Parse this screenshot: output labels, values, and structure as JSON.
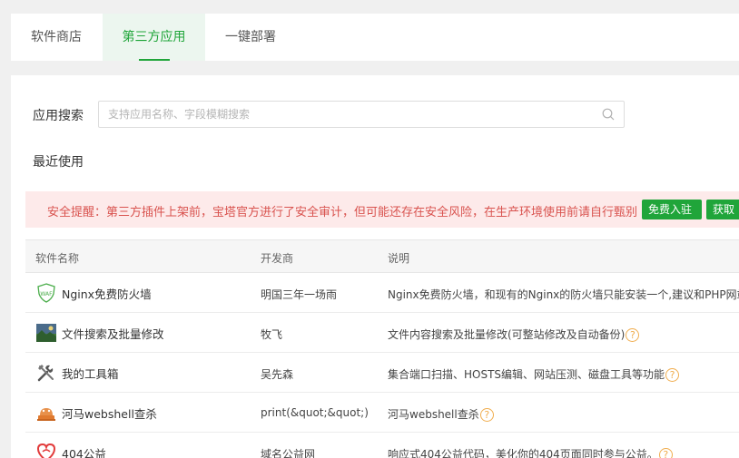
{
  "tabs": [
    {
      "label": "软件商店"
    },
    {
      "label": "第三方应用"
    },
    {
      "label": "一键部署"
    }
  ],
  "search": {
    "label": "应用搜索",
    "placeholder": "支持应用名称、字段模糊搜索"
  },
  "recent": {
    "label": "最近使用"
  },
  "alert": {
    "text": "安全提醒：第三方插件上架前，宝塔官方进行了安全审计，但可能还存在安全风险，在生产环境使用前请自行甄别",
    "button1": "免费入驻",
    "button2": "获取"
  },
  "table": {
    "headers": [
      "软件名称",
      "开发商",
      "说明"
    ],
    "rows": [
      {
        "name": "Nginx免费防火墙",
        "developer": "明国三年一场雨",
        "description": "Nginx免费防火墙，和现有的Nginx的防火墙只能安装一个,建议和PHP网站",
        "help": false,
        "icon": "waf-shield-icon"
      },
      {
        "name": "文件搜索及批量修改",
        "developer": "牧飞",
        "description": "文件内容搜索及批量修改(可整站修改及自动备份)",
        "help": true,
        "icon": "landscape-photo-icon"
      },
      {
        "name": "我的工具箱",
        "developer": "吴先森",
        "description": "集合端口扫描、HOSTS编辑、网站压测、磁盘工具等功能",
        "help": true,
        "icon": "tools-icon"
      },
      {
        "name": "河马webshell查杀",
        "developer": "print(&quot;&quot;)",
        "description": "河马webshell查杀",
        "help": true,
        "icon": "hippo-icon"
      },
      {
        "name": "404公益",
        "developer": "域名公益网",
        "description": "响应式404公益代码，美化你的404页面同时参与公益。",
        "help": true,
        "icon": "heart-charity-icon"
      }
    ]
  },
  "colors": {
    "accent": "#20a53a",
    "alert_text": "#d9534f",
    "alert_bg": "#fdeaea",
    "help": "#f0ad4e"
  }
}
